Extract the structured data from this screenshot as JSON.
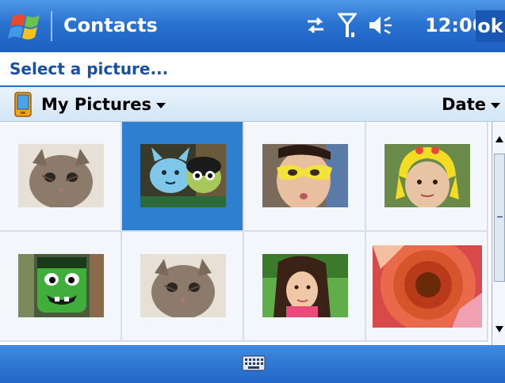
{
  "titlebar": {
    "app_title": "Contacts",
    "clock": "12:00",
    "ok_label": "ok",
    "status_icons": [
      "sync-icon",
      "signal-antenna-icon",
      "speaker-volume-icon"
    ]
  },
  "prompt": "Select a picture...",
  "folderbar": {
    "folder": "My Pictures",
    "sort": "Date"
  },
  "pictures": [
    {
      "name": "kitten",
      "selected": false
    },
    {
      "name": "plush-toys",
      "selected": true
    },
    {
      "name": "yellow-mask-face",
      "selected": false
    },
    {
      "name": "girl-yellow-hat",
      "selected": false
    },
    {
      "name": "green-monster-toy",
      "selected": false
    },
    {
      "name": "kitten",
      "selected": false
    },
    {
      "name": "woman-portrait",
      "selected": false
    },
    {
      "name": "flower-macro",
      "selected": false
    }
  ],
  "colors": {
    "titlebar": "#2a72d0",
    "selection": "#2f7fd0",
    "prompt_text": "#1b4fa3"
  },
  "bottombar": {
    "icon": "keyboard-icon"
  }
}
